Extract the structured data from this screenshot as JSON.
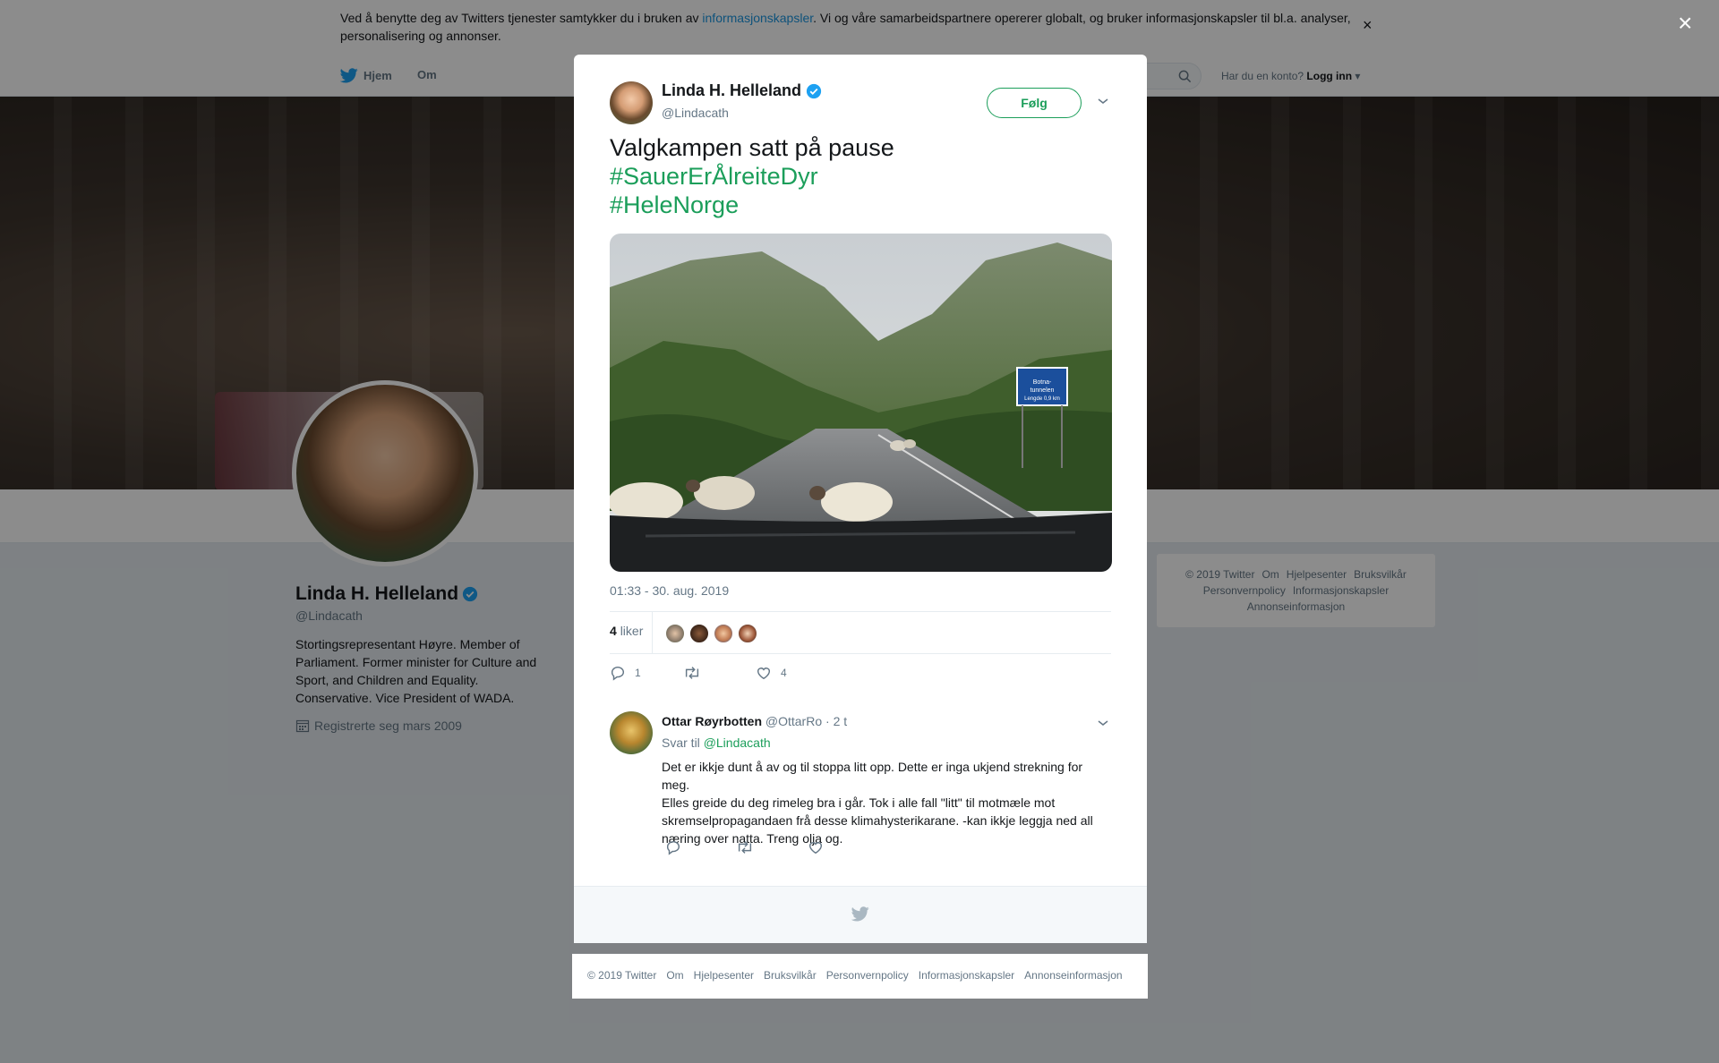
{
  "cookie_banner": {
    "text_before": "Ved å benytte deg av Twitters tjenester samtykker du i bruken av ",
    "link": "informasjonskapsler",
    "text_after": ". Vi og våre samarbeidspartnere opererer globalt, og bruker informasjonskapsler til bl.a. analyser, personalisering og annonser.",
    "close": "×"
  },
  "nav": {
    "home": "Hjem",
    "about": "Om",
    "login_prompt": "Har du en konto?",
    "login": "Logg inn"
  },
  "profile": {
    "name": "Linda H. Helleland",
    "handle": "@Lindacath",
    "bio": "Stortingsrepresentant Høyre. Member of Parliament. Former minister for Culture and Sport, and Children and Equality. Conservative. Vice President of WADA.",
    "joined": "Registrerte seg mars 2009"
  },
  "side_footer": {
    "links": [
      "© 2019 Twitter",
      "Om",
      "Hjelpesenter",
      "Bruksvilkår",
      "Personvernpolicy",
      "Informasjonskapsler",
      "Annonseinformasjon"
    ]
  },
  "overlay": {
    "close": "×"
  },
  "tweet": {
    "author_name": "Linda H. Helleland",
    "author_handle": "@Lindacath",
    "follow_label": "Følg",
    "text_line1": "Valgkampen satt på pause",
    "hashtag1": "#SauerErÅlreiteDyr",
    "hashtag2": "#HeleNorge",
    "sign_text1": "Botna-",
    "sign_text2": "tunnelen",
    "sign_text3": "Lengde 0,9 km",
    "timestamp": "01:33 - 30. aug. 2019",
    "likes_number": "4",
    "likes_word": "liker",
    "reply_count": "1",
    "like_count": "4"
  },
  "reply": {
    "author_name": "Ottar Røyrbotten",
    "author_handle": "@OttarRo",
    "time": "· 2 t",
    "reply_to_prefix": "Svar til",
    "reply_to_handle": "@Lindacath",
    "text": "Det er ikkje dunt å av og til stoppa litt opp. Dette er inga ukjend strekning for meg.\nElles greide du deg rimeleg bra i går. Tok i alle fall \"litt\" til motmæle mot skremselpropagandaen frå desse klimahysterikarane. -kan ikkje leggja ned all næring over natta. Treng olja og."
  },
  "bottom_footer": {
    "links": [
      "© 2019 Twitter",
      "Om",
      "Hjelpesenter",
      "Bruksvilkår",
      "Personvernpolicy",
      "Informasjonskapsler",
      "Annonseinformasjon"
    ]
  },
  "colors": {
    "accent_green": "#1b9e5a",
    "twitter_blue": "#1da1f2",
    "verified_blue": "#1da1f2",
    "text_gray": "#657786"
  },
  "icons": [
    "twitter-bird-icon",
    "search-icon",
    "verified-badge-icon",
    "chevron-down-icon",
    "calendar-icon",
    "reply-icon",
    "retweet-icon",
    "like-icon",
    "close-icon"
  ]
}
